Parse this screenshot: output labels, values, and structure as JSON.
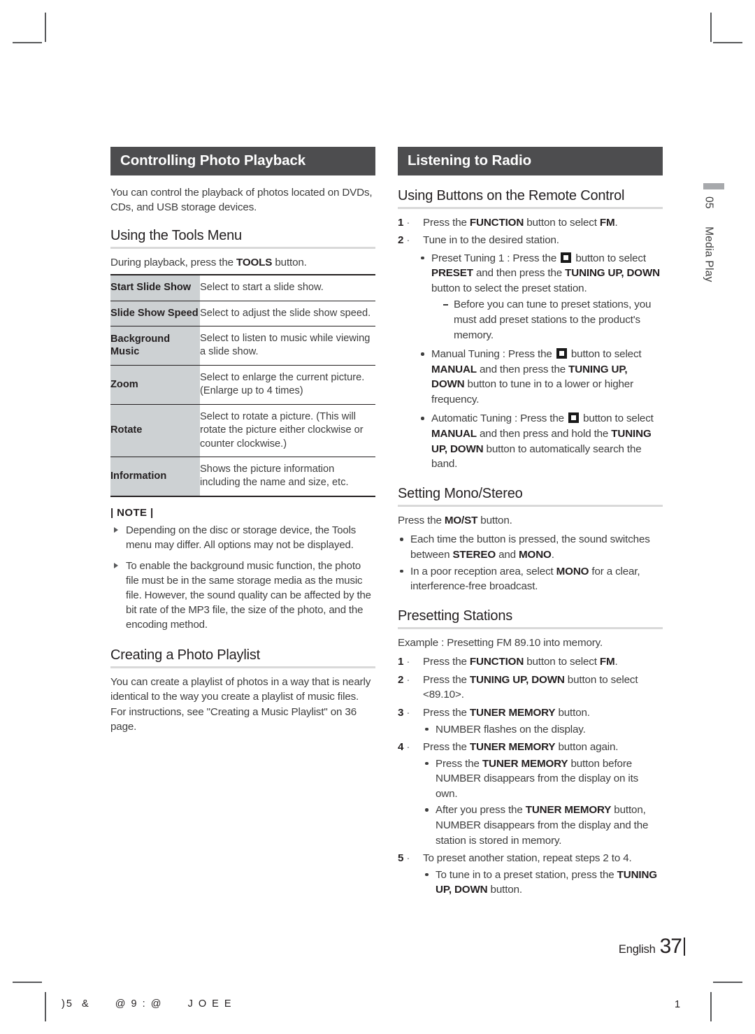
{
  "left_column": {
    "section_bar": "Controlling Photo Playback",
    "intro": "You can control the playback of photos located on DVDs, CDs, and USB storage devices.",
    "tools_menu": {
      "heading": "Using the Tools Menu",
      "lead_before": "During playback, press the ",
      "lead_bold": "TOOLS",
      "lead_after": " button.",
      "table": {
        "rows": [
          {
            "name": "Start Slide Show",
            "desc": "Select to start a slide show."
          },
          {
            "name": "Slide Show Speed",
            "desc": "Select to adjust the slide show speed."
          },
          {
            "name": "Background Music",
            "desc": "Select to listen to music while viewing a slide show."
          },
          {
            "name": "Zoom",
            "desc": "Select to enlarge the current picture. (Enlarge up to 4 times)"
          },
          {
            "name": "Rotate",
            "desc": "Select to rotate a picture. (This will rotate the picture either clockwise or counter clockwise.)"
          },
          {
            "name": "Information",
            "desc": "Shows the picture information including the name and size, etc."
          }
        ]
      }
    },
    "note": {
      "title": "| NOTE |",
      "items": [
        "Depending on the disc or storage device, the Tools menu may differ. All options may not be displayed.",
        "To enable the background music function, the photo file must be in the same storage media as the music file. However, the sound quality can be affected by the bit rate of the MP3 file, the size of the photo, and the encoding method."
      ]
    },
    "photo_playlist": {
      "heading": "Creating a Photo Playlist",
      "body": "You can create a playlist of photos in a way that is nearly identical to the way you create a playlist of music files. For instructions, see \"Creating a Music Playlist\" on 36 page."
    }
  },
  "right_column": {
    "section_bar": "Listening to Radio",
    "remote": {
      "heading": "Using Buttons on the Remote Control",
      "step1": {
        "num": "1",
        "pre": "Press the ",
        "bold1": "FUNCTION",
        "mid": " button to select ",
        "bold2": "FM",
        "post": "."
      },
      "step2": {
        "num": "2",
        "text": "Tune in to the desired station."
      },
      "preset_tuning": {
        "lead": "Preset Tuning 1 : Press the",
        "after_icon": "button",
        "line2_pre": "to select ",
        "line2_bold": "PRESET",
        "line2_mid": " and then press the ",
        "line3_bold": "TUNING UP, DOWN",
        "line3_post": " button to select the preset station.",
        "sub": "Before you can tune to preset stations, you must add preset stations to the product's memory."
      },
      "manual_tuning": {
        "lead": "Manual Tuning : Press the",
        "after_icon": "button",
        "line2_pre": "to select ",
        "line2_bold": "MANUAL",
        "line2_mid": " and then press the ",
        "line3_bold": "TUNING UP, DOWN",
        "line3_post": " button to tune in to a lower or higher frequency."
      },
      "automatic_tuning": {
        "lead": "Automatic Tuning : Press the",
        "after_icon": "button",
        "line2_pre": "to select ",
        "line2_bold": "MANUAL",
        "line2_mid": " and then press and hold the ",
        "line3_bold": "TUNING UP, DOWN",
        "line3_post": " button to automatically search the band."
      }
    },
    "mono_stereo": {
      "heading": "Setting Mono/Stereo",
      "lead_pre": "Press the ",
      "lead_bold": "MO/ST",
      "lead_post": " button.",
      "bullet1_pre": "Each time the button is pressed, the sound switches between ",
      "bullet1_b1": "STEREO",
      "bullet1_mid": " and ",
      "bullet1_b2": "MONO",
      "bullet1_post": ".",
      "bullet2_pre": "In a poor reception area, select ",
      "bullet2_b1": "MONO",
      "bullet2_post": " for a clear, interference-free broadcast."
    },
    "presetting": {
      "heading": "Presetting Stations",
      "example": "Example : Presetting FM 89.10 into memory.",
      "step1": {
        "num": "1",
        "pre": "Press the ",
        "b1": "FUNCTION",
        "mid": " button to select ",
        "b2": "FM",
        "post": "."
      },
      "step2": {
        "num": "2",
        "pre": "Press the ",
        "b1": "TUNING UP, DOWN",
        "post": " button to select <89.10>."
      },
      "step3": {
        "num": "3",
        "pre": "Press the ",
        "b1": "TUNER MEMORY",
        "post": " button.",
        "bullet": "NUMBER flashes on the display."
      },
      "step4": {
        "num": "4",
        "pre": "Press the ",
        "b1": "TUNER MEMORY",
        "post": " button again.",
        "bullet1_pre": "Press the ",
        "bullet1_b": "TUNER MEMORY",
        "bullet1_post": " button before NUMBER disappears from the display on its own.",
        "bullet2_pre": "After you press the ",
        "bullet2_b": "TUNER MEMORY",
        "bullet2_post": " button, NUMBER disappears from the display and the station is stored in memory."
      },
      "step5": {
        "num": "5",
        "text": "To preset another station, repeat steps 2 to 4.",
        "bullet_pre": "To tune in to a preset station, press the ",
        "bullet_b": "TUNING UP, DOWN",
        "bullet_post": " button."
      }
    }
  },
  "chapter_tab": {
    "number": "05",
    "label": "Media Play"
  },
  "footer": {
    "language": "English",
    "page": "37"
  },
  "print_marks": {
    "strip": ")5  &      @ 9 : @      J O E E",
    "sheet_number": "1"
  }
}
